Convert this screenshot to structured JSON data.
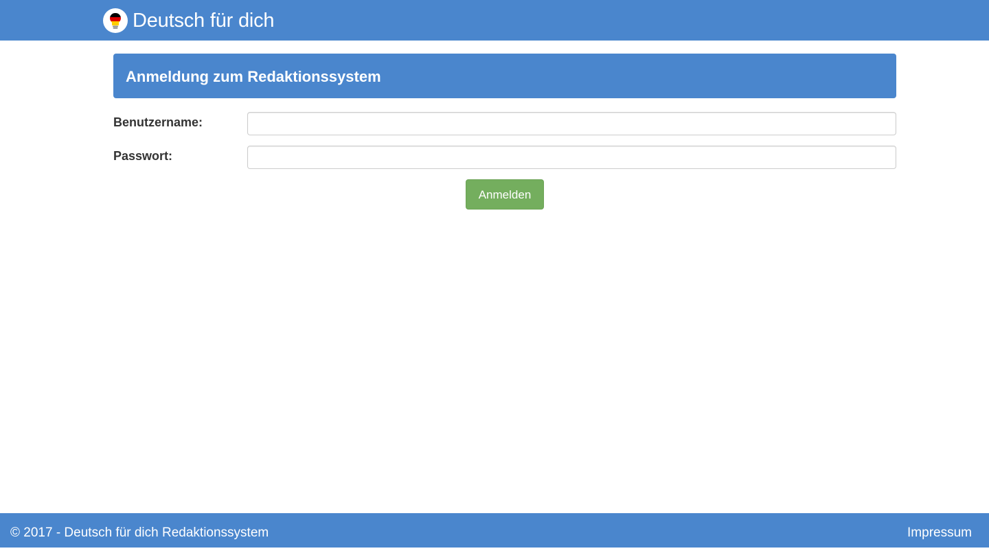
{
  "header": {
    "brand_title": "Deutsch für dich",
    "logo_icon": "germany-lightbulb-icon"
  },
  "panel": {
    "title": "Anmeldung zum Redaktionssystem"
  },
  "form": {
    "username_label": "Benutzername:",
    "username_value": "",
    "password_label": "Passwort:",
    "password_value": "",
    "submit_label": "Anmelden"
  },
  "footer": {
    "copyright": "© 2017 - Deutsch für dich Redaktionssystem",
    "impressum_label": "Impressum"
  },
  "colors": {
    "primary": "#4a86cd",
    "button_success": "#74ae5e",
    "text": "#333333",
    "flag_black": "#000000",
    "flag_red": "#dd0000",
    "flag_gold": "#ffce00"
  }
}
